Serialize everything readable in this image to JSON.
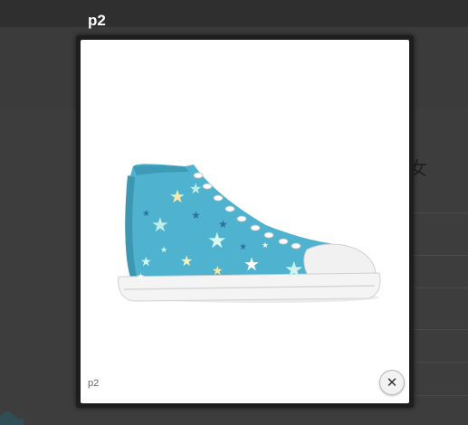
{
  "lightbox": {
    "title": "p2",
    "caption": "p2",
    "close_icon": "close-icon",
    "close_glyph": "✕",
    "image_subject": "sneaker"
  },
  "background": {
    "partial_text": "女"
  },
  "colors": {
    "overlay": "#3a3a3a",
    "shoe_canvas": "#4fb3cf",
    "sole": "#f2f2f2"
  }
}
